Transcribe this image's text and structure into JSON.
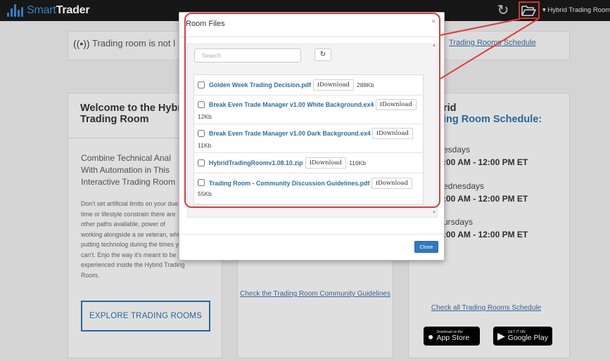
{
  "topbar": {
    "brand_prefix": "Smart",
    "brand_suffix": "Trader",
    "room_menu_label": "▾ Hybrid Trading Room"
  },
  "background": {
    "signal_text": "Trading room is not l",
    "signal_link": "Trading Rooms Schedule",
    "welcome_title": "Welcome to the Hybrid Trading Room",
    "lead": "Combine Technical Anal With Automation in This Interactive Trading Room",
    "body": "Don't set artificial limits on your due to time or lifestyle constrain there are other paths available, power of working alongside a se veteran, while putting technolog during the times you can't. Enjo the way it's meant to be experienced inside the Hybrid Trading Room.",
    "explore_button": "EXPLORE TRADING ROOMS",
    "community_link": "Check the Trading Room Community Guidelines",
    "schedule_title_prefix": "rid",
    "schedule_title": "ing Room Schedule:",
    "schedule": [
      {
        "day": "esdays",
        "time": ":00 AM - 12:00 PM ET"
      },
      {
        "day": "ednesdays",
        "time": ":00 AM - 12:00 PM ET"
      },
      {
        "day": "ursdays",
        "time": ":00 AM - 12:00 PM ET"
      }
    ],
    "schedule_link": "Check all Trading Rooms Schedule",
    "app_store_small": "Download on the",
    "app_store_big": "App Store",
    "google_small": "GET IT ON",
    "google_big": "Google Play"
  },
  "modal": {
    "title": "Room Files",
    "close_x": "×",
    "search_placeholder": "Search",
    "refresh_glyph": "↻",
    "download_label": "⭳Download",
    "close_button": "Close",
    "files": [
      {
        "name": "Golden Week Trading Decision.pdf",
        "size": "288Kb"
      },
      {
        "name": "Break Even Trade Manager v1.00 White Background.ex4",
        "size": "12Kb"
      },
      {
        "name": "Break Even Trade Manager v1.00 Dark Background.ex4",
        "size": "11Kb"
      },
      {
        "name": "HybridTradingRoomv1.08.10.zip",
        "size": "116Kb"
      },
      {
        "name": "Trading Room - Community Discussion Guidelines.pdf",
        "size": "55Kb"
      }
    ]
  },
  "colors": {
    "annotation": "#e03a3a",
    "link": "#2e6da4",
    "primary_button": "#2f78c0"
  }
}
